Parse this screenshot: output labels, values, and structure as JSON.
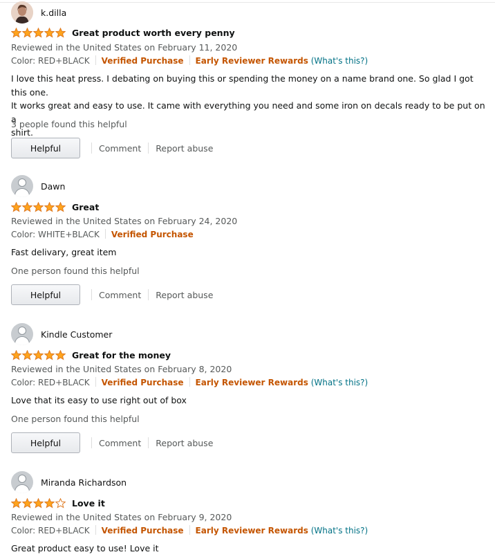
{
  "reviews": [
    {
      "name": "k.dilla",
      "avatar": "photo",
      "rating": 5,
      "title": "Great product worth every penny",
      "date": "Reviewed in the United States on February 11, 2020",
      "color": "Color: RED+BLACK",
      "verified": "Verified Purchase",
      "early": "Early Reviewer Rewards",
      "whats_this": "(What's this?)",
      "body": [
        "I love this heat press. I debating on buying this or spending the money on a name brand one. So glad I got this one.",
        "It works great and easy to use. It came with everything you need and some iron on decals ready to be put on a",
        "shirt."
      ],
      "helpful_count": "3 people found this helpful",
      "helpful": "Helpful",
      "comment": "Comment",
      "report": "Report abuse"
    },
    {
      "name": "Dawn",
      "avatar": "generic",
      "rating": 5,
      "title": "Great",
      "date": "Reviewed in the United States on February 24, 2020",
      "color": "Color: WHITE+BLACK",
      "verified": "Verified Purchase",
      "body": [
        "Fast delivary, great item"
      ],
      "helpful_count": "One person found this helpful",
      "helpful": "Helpful",
      "comment": "Comment",
      "report": "Report abuse"
    },
    {
      "name": "Kindle Customer",
      "avatar": "generic",
      "rating": 5,
      "title": "Great for the money",
      "date": "Reviewed in the United States on February 8, 2020",
      "color": "Color: RED+BLACK",
      "verified": "Verified Purchase",
      "early": "Early Reviewer Rewards",
      "whats_this": "(What's this?)",
      "body": [
        "Love that its easy to use right out of box"
      ],
      "helpful_count": "One person found this helpful",
      "helpful": "Helpful",
      "comment": "Comment",
      "report": "Report abuse"
    },
    {
      "name": "Miranda Richardson",
      "avatar": "generic",
      "rating": 4,
      "title": "Love it",
      "date": "Reviewed in the United States on February 9, 2020",
      "color": "Color: RED+BLACK",
      "verified": "Verified Purchase",
      "early": "Early Reviewer Rewards",
      "whats_this": "(What's this?)",
      "body": [
        "Great product easy to use! Love it"
      ]
    }
  ],
  "colors": {
    "star_fill": "#ffa41c",
    "star_stroke": "#de7921",
    "link": "#007185",
    "badge": "#c45500"
  }
}
